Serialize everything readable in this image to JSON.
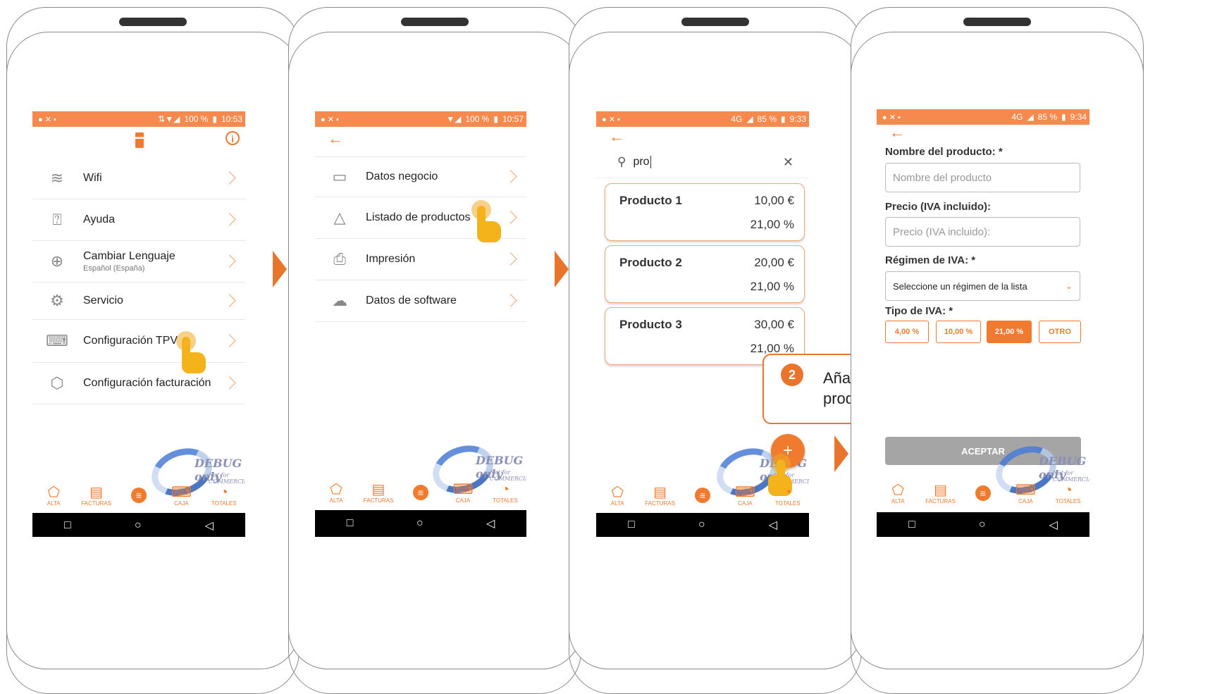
{
  "status": {
    "s1_right": "100 %",
    "s1_time": "10:53",
    "s2_right": "100 %",
    "s2_time": "10:57",
    "s3_net": "4G",
    "s3_right": "85 %",
    "s3_time": "9:33",
    "s4_net": "4G",
    "s4_right": "85 %",
    "s4_time": "9:34"
  },
  "screen1": {
    "items": [
      {
        "label": "Wifi",
        "icon": "wifi-icon"
      },
      {
        "label": "Ayuda",
        "icon": "help-icon"
      },
      {
        "label": "Cambiar Lenguaje",
        "sub": "Español (España)",
        "icon": "globe-icon"
      },
      {
        "label": "Servicio",
        "icon": "gear-icon"
      },
      {
        "label": "Configuración TPV",
        "icon": "pos-icon"
      },
      {
        "label": "Configuración facturación",
        "icon": "tag-icon"
      }
    ]
  },
  "screen2": {
    "items": [
      {
        "label": "Datos negocio",
        "icon": "store-icon"
      },
      {
        "label": "Listado de productos",
        "icon": "shapes-icon"
      },
      {
        "label": "Impresión",
        "icon": "printer-icon"
      },
      {
        "label": "Datos de software",
        "icon": "cloud-download-icon"
      }
    ]
  },
  "screen3": {
    "search_value": "pro",
    "products": [
      {
        "name": "Producto 1",
        "price": "10,00 €",
        "iva": "21,00 %"
      },
      {
        "name": "Producto 2",
        "price": "20,00 €",
        "iva": "21,00 %"
      },
      {
        "name": "Producto 3",
        "price": "30,00 €",
        "iva": "21,00 %"
      }
    ],
    "fab": "+",
    "callout": {
      "number": "2",
      "text": "Añadir producto"
    }
  },
  "screen4": {
    "name_label": "Nombre del producto: *",
    "name_placeholder": "Nombre del producto",
    "price_label": "Precio (IVA incluido):",
    "price_placeholder": "Precio (IVA incluido):",
    "regime_label": "Régimen de IVA: *",
    "regime_select": "Seleccione un régimen de la lista",
    "type_label": "Tipo de IVA: *",
    "iva_options": [
      "4,00 %",
      "10,00 %",
      "21,00 %",
      "OTRO"
    ],
    "iva_selected": "21,00 %",
    "accept": "ACEPTAR"
  },
  "nav": {
    "alta": "ALTA",
    "facturas": "FACTURAS",
    "caja": "CAJA",
    "totales": "TOTALES"
  },
  "watermark": {
    "main": "DEBUG only",
    "sub": "Not for COMMERCIAL"
  },
  "colors": {
    "accent": "#f07a2e",
    "statusbar": "#f5894e",
    "arrow": "#e9742c"
  }
}
